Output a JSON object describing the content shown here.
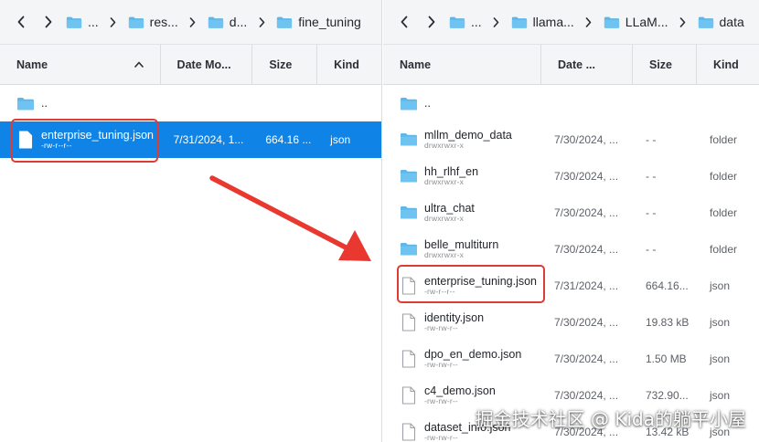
{
  "left_pane": {
    "breadcrumb": [
      "...",
      "res...",
      "d...",
      "fine_tuning"
    ],
    "columns": {
      "name": "Name",
      "date": "Date Mo...",
      "size": "Size",
      "kind": "Kind"
    },
    "rows": [
      {
        "name": "..",
        "perm": "",
        "date": "",
        "size": "",
        "kind": "",
        "type": "folder"
      },
      {
        "name": "enterprise_tuning.json",
        "perm": "-rw-r--r--",
        "date": "7/31/2024, 1...",
        "size": "664.16 ...",
        "kind": "json",
        "type": "file",
        "selected": true
      }
    ]
  },
  "right_pane": {
    "breadcrumb": [
      "...",
      "llama...",
      "LLaM...",
      "data"
    ],
    "columns": {
      "name": "Name",
      "date": "Date ...",
      "size": "Size",
      "kind": "Kind"
    },
    "rows": [
      {
        "name": "..",
        "perm": "",
        "date": "",
        "size": "",
        "kind": "",
        "type": "folder"
      },
      {
        "name": "mllm_demo_data",
        "perm": "drwxrwxr-x",
        "date": "7/30/2024, ...",
        "size": "- -",
        "kind": "folder",
        "type": "folder"
      },
      {
        "name": "hh_rlhf_en",
        "perm": "drwxrwxr-x",
        "date": "7/30/2024, ...",
        "size": "- -",
        "kind": "folder",
        "type": "folder"
      },
      {
        "name": "ultra_chat",
        "perm": "drwxrwxr-x",
        "date": "7/30/2024, ...",
        "size": "- -",
        "kind": "folder",
        "type": "folder"
      },
      {
        "name": "belle_multiturn",
        "perm": "drwxrwxr-x",
        "date": "7/30/2024, ...",
        "size": "- -",
        "kind": "folder",
        "type": "folder"
      },
      {
        "name": "enterprise_tuning.json",
        "perm": "-rw-r--r--",
        "date": "7/31/2024, ...",
        "size": "664.16...",
        "kind": "json",
        "type": "file"
      },
      {
        "name": "identity.json",
        "perm": "-rw-rw-r--",
        "date": "7/30/2024, ...",
        "size": "19.83 kB",
        "kind": "json",
        "type": "file"
      },
      {
        "name": "dpo_en_demo.json",
        "perm": "-rw-rw-r--",
        "date": "7/30/2024, ...",
        "size": "1.50 MB",
        "kind": "json",
        "type": "file"
      },
      {
        "name": "c4_demo.json",
        "perm": "-rw-rw-r--",
        "date": "7/30/2024, ...",
        "size": "732.90...",
        "kind": "json",
        "type": "file"
      },
      {
        "name": "dataset_info.json",
        "perm": "-rw-rw-r--",
        "date": "7/30/2024, ...",
        "size": "13.42 kB",
        "kind": "json",
        "type": "file"
      }
    ]
  },
  "watermark": "掘金技术社区 @ Kida的躺平小屋",
  "colors": {
    "selection": "#0f84e6",
    "folder": "#5cb7ea",
    "highlight": "#dc3b36",
    "arrow": "#e8382f"
  },
  "icons": {
    "back": "chevron-left-icon",
    "forward": "chevron-right-icon",
    "folder": "folder-icon",
    "file": "file-icon",
    "sort": "chevron-up-icon"
  }
}
